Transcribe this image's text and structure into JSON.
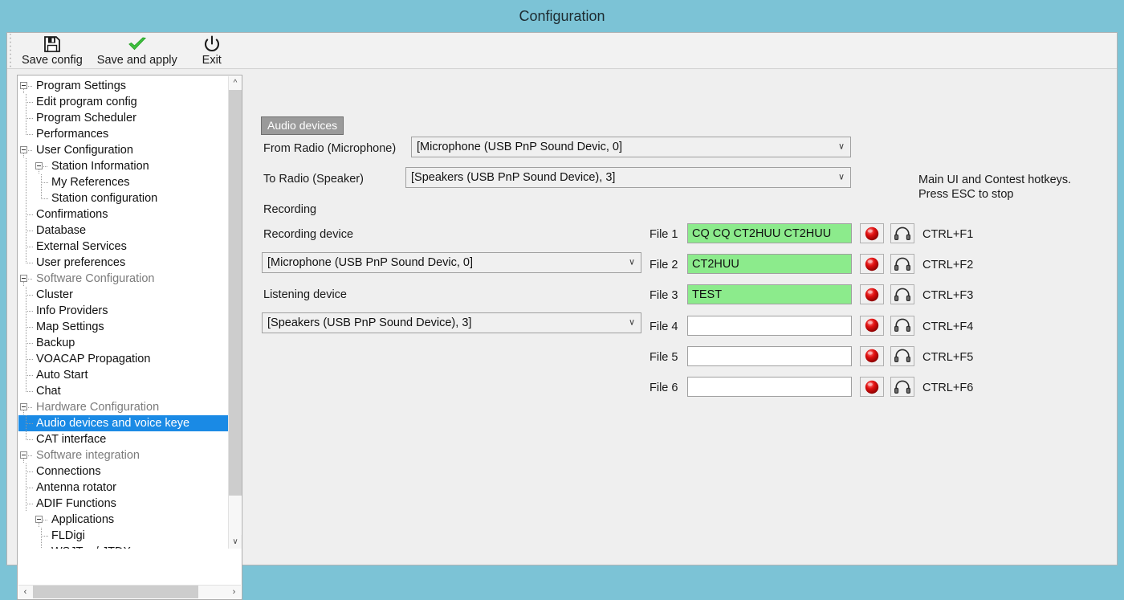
{
  "window": {
    "title": "Configuration",
    "titlebar_color": "#7cc3d6",
    "panel_color": "#efefef"
  },
  "toolbar": {
    "items": [
      {
        "label": "Save config",
        "icon": "floppy-disk-icon"
      },
      {
        "label": "Save and apply",
        "icon": "green-check-icon"
      },
      {
        "label": "Exit",
        "icon": "power-icon"
      }
    ]
  },
  "sidebar": {
    "selected": "Audio devices and voice keye",
    "items": [
      {
        "label": "Program Settings",
        "level": 0,
        "expander": "minus",
        "dim": false
      },
      {
        "label": "Edit program config",
        "level": 1,
        "expander": "none",
        "dim": false
      },
      {
        "label": "Program Scheduler",
        "level": 1,
        "expander": "none",
        "dim": false
      },
      {
        "label": "Performances",
        "level": 1,
        "expander": "none",
        "dim": false
      },
      {
        "label": "User Configuration",
        "level": 0,
        "expander": "minus",
        "dim": false
      },
      {
        "label": "Station Information",
        "level": 1,
        "expander": "minus",
        "dim": false
      },
      {
        "label": "My References",
        "level": 2,
        "expander": "none",
        "dim": false
      },
      {
        "label": "Station configuration",
        "level": 2,
        "expander": "none",
        "dim": false
      },
      {
        "label": "Confirmations",
        "level": 1,
        "expander": "none",
        "dim": false
      },
      {
        "label": "Database",
        "level": 1,
        "expander": "none",
        "dim": false
      },
      {
        "label": "External Services",
        "level": 1,
        "expander": "none",
        "dim": false
      },
      {
        "label": "User preferences",
        "level": 1,
        "expander": "none",
        "dim": false
      },
      {
        "label": "Software Configuration",
        "level": 0,
        "expander": "minus",
        "dim": true
      },
      {
        "label": "Cluster",
        "level": 1,
        "expander": "none",
        "dim": false
      },
      {
        "label": "Info Providers",
        "level": 1,
        "expander": "none",
        "dim": false
      },
      {
        "label": "Map Settings",
        "level": 1,
        "expander": "none",
        "dim": false
      },
      {
        "label": "Backup",
        "level": 1,
        "expander": "none",
        "dim": false
      },
      {
        "label": "VOACAP Propagation",
        "level": 1,
        "expander": "none",
        "dim": false
      },
      {
        "label": "Auto Start",
        "level": 1,
        "expander": "none",
        "dim": false
      },
      {
        "label": "Chat",
        "level": 1,
        "expander": "none",
        "dim": false
      },
      {
        "label": "Hardware Configuration",
        "level": 0,
        "expander": "minus",
        "dim": true
      },
      {
        "label": "Audio devices and voice keye",
        "level": 1,
        "expander": "none",
        "dim": false,
        "selected": true
      },
      {
        "label": "CAT interface",
        "level": 1,
        "expander": "none",
        "dim": false
      },
      {
        "label": "Software integration",
        "level": 0,
        "expander": "minus",
        "dim": true
      },
      {
        "label": "Connections",
        "level": 1,
        "expander": "none",
        "dim": false
      },
      {
        "label": "Antenna rotator",
        "level": 1,
        "expander": "none",
        "dim": false
      },
      {
        "label": "ADIF Functions",
        "level": 1,
        "expander": "none",
        "dim": false
      },
      {
        "label": "Applications",
        "level": 1,
        "expander": "minus",
        "dim": false
      },
      {
        "label": "FLDigi",
        "level": 2,
        "expander": "none",
        "dim": false
      },
      {
        "label": "WSJT-x / JTDX",
        "level": 2,
        "expander": "none",
        "dim": false
      }
    ]
  },
  "main": {
    "tab_label": "Audio devices",
    "from_radio_label": "From Radio (Microphone)",
    "from_radio_value": "[Microphone (USB PnP Sound Devic, 0]",
    "to_radio_label": "To Radio (Speaker)",
    "to_radio_value": "[Speakers (USB PnP Sound Device), 3]",
    "recording_section_label": "Recording",
    "recording_device_label": "Recording device",
    "recording_device_value": "[Microphone (USB PnP Sound Devic, 0]",
    "listening_device_label": "Listening device",
    "listening_device_value": "[Speakers (USB PnP Sound Device), 3]",
    "hint": "Main UI and Contest hotkeys.\nPress ESC to stop",
    "files": [
      {
        "label": "File 1",
        "value": "CQ CQ CT2HUU CT2HUU",
        "filled": true,
        "hotkey": "CTRL+F1"
      },
      {
        "label": "File 2",
        "value": "CT2HUU",
        "filled": true,
        "hotkey": "CTRL+F2"
      },
      {
        "label": "File 3",
        "value": "TEST",
        "filled": true,
        "hotkey": "CTRL+F3"
      },
      {
        "label": "File 4",
        "value": "",
        "filled": false,
        "hotkey": "CTRL+F4"
      },
      {
        "label": "File 5",
        "value": "",
        "filled": false,
        "hotkey": "CTRL+F5"
      },
      {
        "label": "File 6",
        "value": "",
        "filled": false,
        "hotkey": "CTRL+F6"
      }
    ],
    "record_icon_name": "record-button-icon",
    "listen_icon_name": "headphones-icon"
  }
}
